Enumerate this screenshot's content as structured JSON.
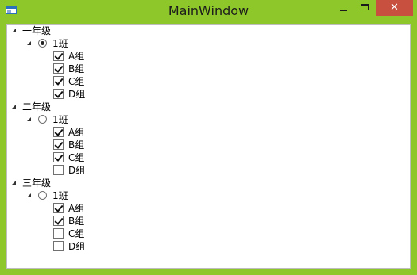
{
  "window": {
    "title": "MainWindow",
    "close_glyph": "✕",
    "icons": {
      "app": "app-window-icon",
      "minimize": "minimize-icon",
      "maximize": "maximize-icon",
      "close": "close-icon"
    },
    "colors": {
      "frame": "#8dc729",
      "close_button": "#c7503f",
      "client_bg": "#ffffff"
    }
  },
  "tree": {
    "grades": [
      {
        "label": "一年级",
        "expanded": true,
        "class": {
          "label": "1班",
          "selected": true,
          "expanded": true,
          "groups": [
            {
              "label": "A组",
              "checked": true
            },
            {
              "label": "B组",
              "checked": true
            },
            {
              "label": "C组",
              "checked": true
            },
            {
              "label": "D组",
              "checked": true
            }
          ]
        }
      },
      {
        "label": "二年级",
        "expanded": true,
        "class": {
          "label": "1班",
          "selected": false,
          "expanded": true,
          "groups": [
            {
              "label": "A组",
              "checked": true
            },
            {
              "label": "B组",
              "checked": true
            },
            {
              "label": "C组",
              "checked": true
            },
            {
              "label": "D组",
              "checked": false
            }
          ]
        }
      },
      {
        "label": "三年级",
        "expanded": true,
        "class": {
          "label": "1班",
          "selected": false,
          "expanded": true,
          "groups": [
            {
              "label": "A组",
              "checked": true
            },
            {
              "label": "B组",
              "checked": true
            },
            {
              "label": "C组",
              "checked": false
            },
            {
              "label": "D组",
              "checked": false
            }
          ]
        }
      }
    ]
  }
}
